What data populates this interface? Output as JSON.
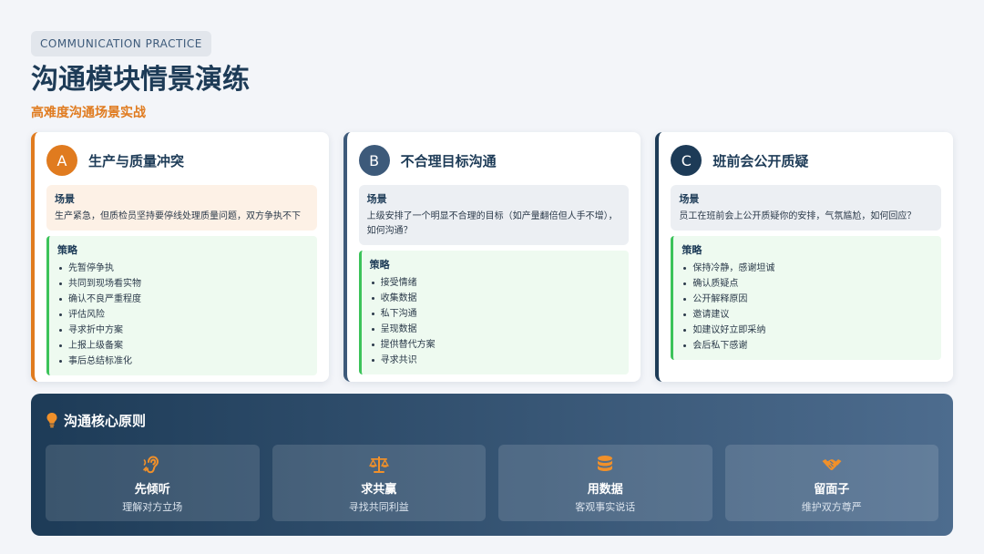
{
  "header": {
    "tag": "COMMUNICATION PRACTICE",
    "title": "沟通模块情景演练",
    "subtitle": "高难度沟通场景实战"
  },
  "cards": [
    {
      "badge": "A",
      "title": "生产与质量冲突",
      "scene_label": "场景",
      "scene_text": "生产紧急，但质检员坚持要停线处理质量问题，双方争执不下",
      "strategy_label": "策略",
      "strategies": [
        "先暂停争执",
        "共同到现场看实物",
        "确认不良严重程度",
        "评估风险",
        "寻求折中方案",
        "上报上级备案",
        "事后总结标准化"
      ]
    },
    {
      "badge": "B",
      "title": "不合理目标沟通",
      "scene_label": "场景",
      "scene_text": "上级安排了一个明显不合理的目标（如产量翻倍但人手不增），如何沟通？",
      "strategy_label": "策略",
      "strategies": [
        "接受情绪",
        "收集数据",
        "私下沟通",
        "呈现数据",
        "提供替代方案",
        "寻求共识"
      ]
    },
    {
      "badge": "C",
      "title": "班前会公开质疑",
      "scene_label": "场景",
      "scene_text": "员工在班前会上公开质疑你的安排，气氛尴尬，如何回应？",
      "strategy_label": "策略",
      "strategies": [
        "保持冷静，感谢坦诚",
        "确认质疑点",
        "公开解释原因",
        "邀请建议",
        "如建议好立即采纳",
        "会后私下感谢"
      ]
    }
  ],
  "principles": {
    "title": "沟通核心原则",
    "icon": "lightbulb-icon",
    "items": [
      {
        "icon": "ear-icon",
        "title": "先倾听",
        "desc": "理解对方立场"
      },
      {
        "icon": "scale-icon",
        "title": "求共赢",
        "desc": "寻找共同利益"
      },
      {
        "icon": "database-icon",
        "title": "用数据",
        "desc": "客观事实说话"
      },
      {
        "icon": "handshake-icon",
        "title": "留面子",
        "desc": "维护双方尊严"
      }
    ]
  },
  "colors": {
    "accent_orange": "#e07b1f",
    "navy": "#1d3b57",
    "slate": "#3d5a7a",
    "strategy_green": "#3cc35a"
  }
}
